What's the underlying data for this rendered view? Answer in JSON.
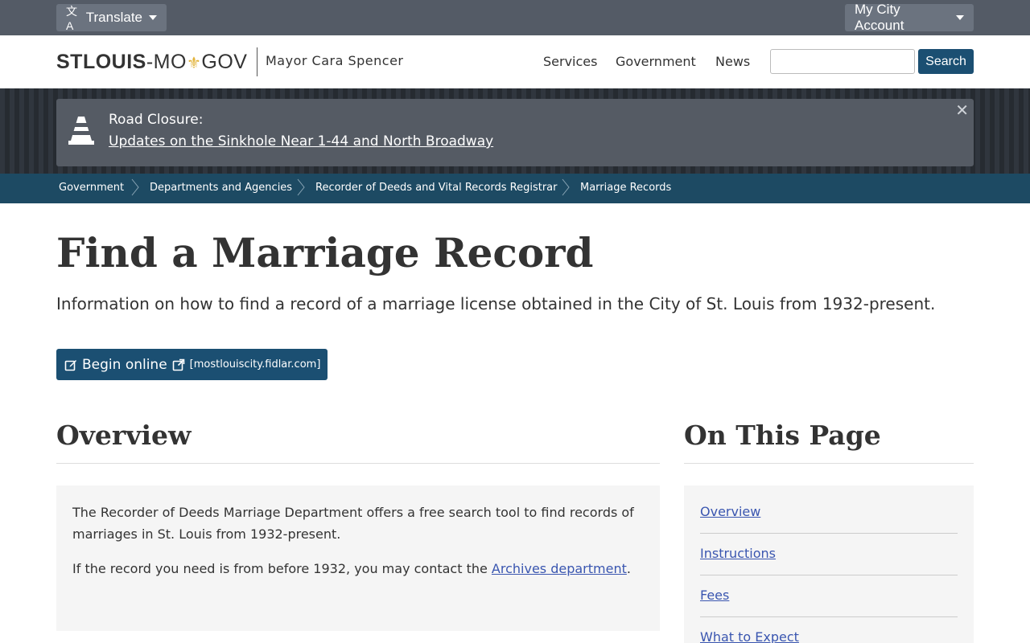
{
  "utility": {
    "translate_label": "Translate",
    "account_label": "My City Account"
  },
  "header": {
    "logo_bold": "STLOUIS",
    "logo_rest_a": "-MO",
    "logo_rest_b": "GOV",
    "mayor": "Mayor Cara Spencer",
    "nav": [
      "Services",
      "Government",
      "News"
    ],
    "search_placeholder": "",
    "search_button": "Search"
  },
  "alert": {
    "title": "Road Closure:",
    "link_text": "Updates on the Sinkhole Near 1-44 and North Broadway",
    "close_glyph": "✕"
  },
  "breadcrumb": [
    "Government",
    "Departments and Agencies",
    "Recorder of Deeds and Vital Records Registrar",
    "Marriage Records"
  ],
  "main": {
    "title": "Find a Marriage Record",
    "subtitle": "Information on how to find a record of a marriage license obtained in the City of St. Louis from 1932-present.",
    "begin_label": "Begin online",
    "begin_domain": "[mostlouiscity.fidlar.com]"
  },
  "overview": {
    "heading": "Overview",
    "p1": "The Recorder of Deeds Marriage Department offers a free search tool to find records of marriages in St. Louis from 1932-present.",
    "p2_before": "If the record you need is from before 1932, you may contact the ",
    "p2_link": "Archives department",
    "p2_after": "."
  },
  "toc": {
    "heading": "On This Page",
    "items": [
      "Overview",
      "Instructions",
      "Fees",
      "What to Expect"
    ]
  },
  "colors": {
    "utility_bar": "#545b66",
    "brand_blue": "#1b4f72",
    "breadcrumb_bg": "#1d4a63",
    "link": "#3a56b0",
    "fleur": "#e2b33a"
  }
}
